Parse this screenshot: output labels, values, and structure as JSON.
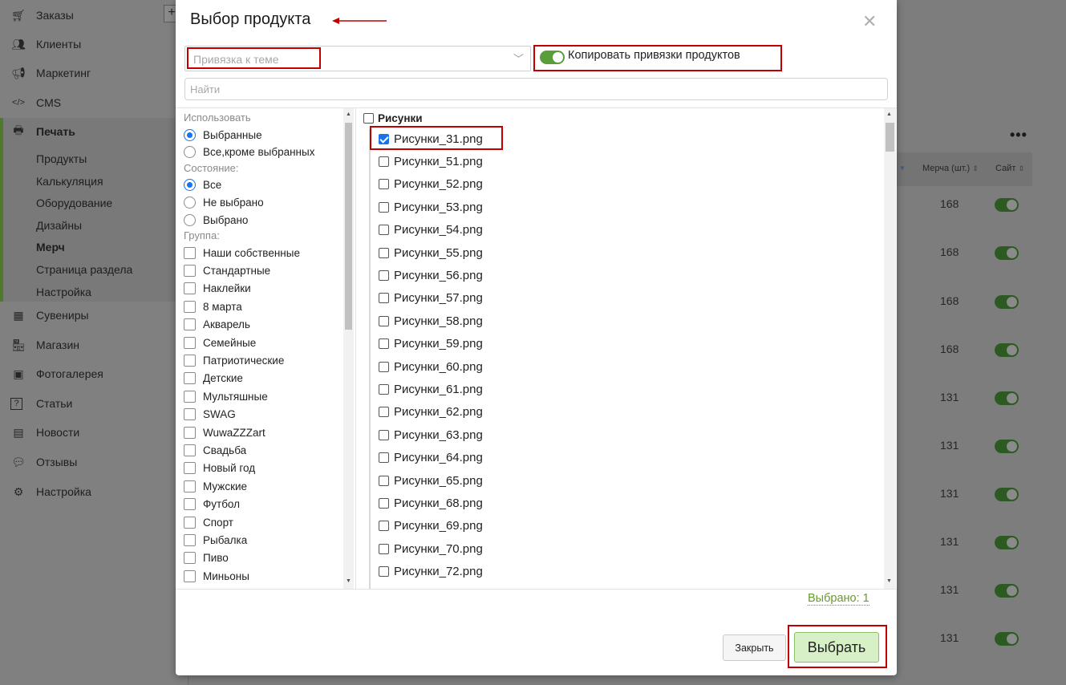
{
  "sidebar": {
    "items": [
      {
        "label": "Заказы",
        "icon": "cart-icon"
      },
      {
        "label": "Клиенты",
        "icon": "users-icon"
      },
      {
        "label": "Маркетинг",
        "icon": "megaphone-icon"
      },
      {
        "label": "CMS",
        "icon": "code-icon"
      },
      {
        "label": "Печать",
        "icon": "printer-icon"
      },
      {
        "label": "Сувениры",
        "icon": "boxes-icon"
      },
      {
        "label": "Магазин",
        "icon": "shop-icon"
      },
      {
        "label": "Фотогалерея",
        "icon": "gallery-icon"
      },
      {
        "label": "Статьи",
        "icon": "help-icon"
      },
      {
        "label": "Новости",
        "icon": "news-icon"
      },
      {
        "label": "Отзывы",
        "icon": "chat-icon"
      },
      {
        "label": "Настройка",
        "icon": "gears-icon"
      }
    ],
    "submenu": [
      "Продукты",
      "Калькуляция",
      "Оборудование",
      "Дизайны",
      "Мерч",
      "Страница раздела",
      "Настройка"
    ],
    "active_submenu": "Мерч"
  },
  "background_table": {
    "columns": [
      "Мерча (шт.)",
      "Сайт"
    ],
    "merch_values": [
      "168",
      "168",
      "168",
      "168",
      "131",
      "131",
      "131",
      "131",
      "131",
      "131"
    ]
  },
  "modal": {
    "title": "Выбор продукта",
    "theme_placeholder": "Привязка к теме",
    "copy_toggle_label": "Копировать привязки продуктов",
    "search_placeholder": "Найти",
    "filters": {
      "use_heading": "Использовать",
      "use_options": [
        "Выбранные",
        "Все,кроме выбранных"
      ],
      "use_selected": "Выбранные",
      "state_heading": "Состояние:",
      "state_options": [
        "Все",
        "Не выбрано",
        "Выбрано"
      ],
      "state_selected": "Все",
      "group_heading": "Группа:",
      "groups": [
        "Наши собственные",
        "Стандартные",
        "Наклейки",
        "8 марта",
        "Акварель",
        "Семейные",
        "Патриотические",
        "Детские",
        "Мультяшные",
        "SWAG",
        "WuwaZZZart",
        "Свадьба",
        "Новый год",
        "Мужские",
        "Футбол",
        "Спорт",
        "Рыбалка",
        "Пиво",
        "Миньоны"
      ]
    },
    "product_group": "Рисунки",
    "products": [
      {
        "name": "Рисунки_31.png",
        "checked": true
      },
      {
        "name": "Рисунки_51.png",
        "checked": false
      },
      {
        "name": "Рисунки_52.png",
        "checked": false
      },
      {
        "name": "Рисунки_53.png",
        "checked": false
      },
      {
        "name": "Рисунки_54.png",
        "checked": false
      },
      {
        "name": "Рисунки_55.png",
        "checked": false
      },
      {
        "name": "Рисунки_56.png",
        "checked": false
      },
      {
        "name": "Рисунки_57.png",
        "checked": false
      },
      {
        "name": "Рисунки_58.png",
        "checked": false
      },
      {
        "name": "Рисунки_59.png",
        "checked": false
      },
      {
        "name": "Рисунки_60.png",
        "checked": false
      },
      {
        "name": "Рисунки_61.png",
        "checked": false
      },
      {
        "name": "Рисунки_62.png",
        "checked": false
      },
      {
        "name": "Рисунки_63.png",
        "checked": false
      },
      {
        "name": "Рисунки_64.png",
        "checked": false
      },
      {
        "name": "Рисунки_65.png",
        "checked": false
      },
      {
        "name": "Рисунки_68.png",
        "checked": false
      },
      {
        "name": "Рисунки_69.png",
        "checked": false
      },
      {
        "name": "Рисунки_70.png",
        "checked": false
      },
      {
        "name": "Рисунки_72.png",
        "checked": false
      }
    ],
    "selected_count_label": "Выбрано: 1",
    "close_button": "Закрыть",
    "select_button": "Выбрать"
  },
  "colors": {
    "accent_green": "#5a9e3c",
    "annotation_red": "#c00000",
    "radio_blue": "#1a73e8"
  }
}
